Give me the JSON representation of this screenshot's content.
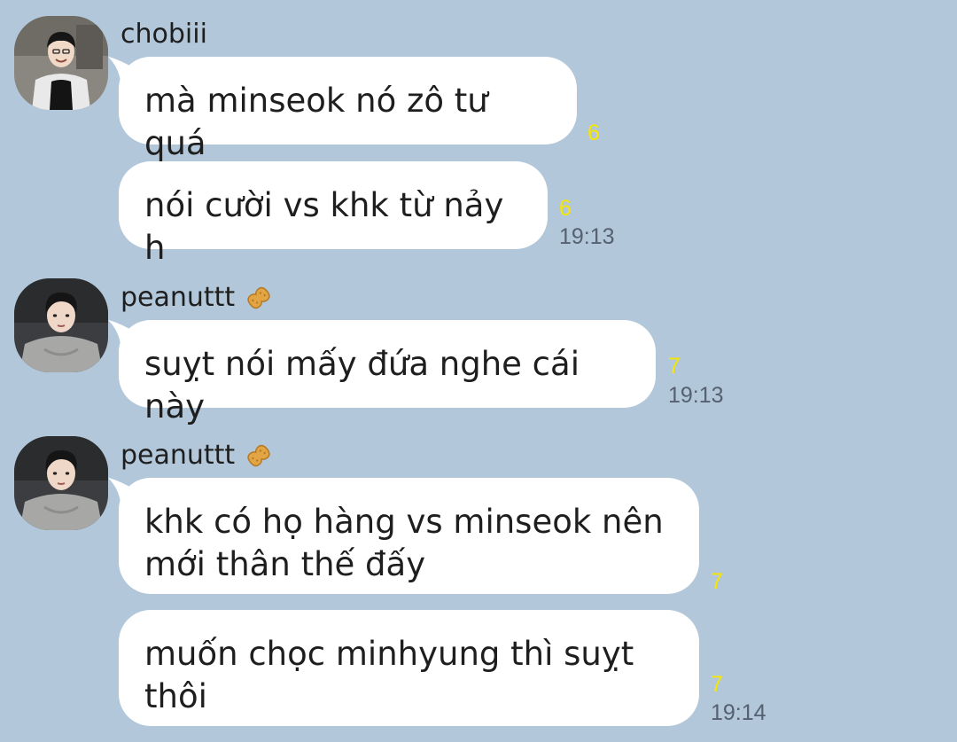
{
  "messages": [
    {
      "sender": "chobiii",
      "avatar_icon": "profile-photo-boy-hoodie-icon",
      "bubbles": [
        {
          "text": "mà minseok nó zô tư quá",
          "unread": "6",
          "time": ""
        },
        {
          "text": "nói cười vs khk từ nảy h",
          "unread": "6",
          "time": "19:13"
        }
      ]
    },
    {
      "sender": "peanuttt",
      "sender_emoji": "peanut-icon",
      "avatar_icon": "profile-photo-boy-gray-hoodie-icon",
      "bubbles": [
        {
          "text": "suỵt nói mấy đứa nghe cái này",
          "unread": "7",
          "time": "19:13"
        }
      ]
    },
    {
      "sender": "peanuttt",
      "sender_emoji": "peanut-icon",
      "avatar_icon": "profile-photo-boy-gray-hoodie-icon",
      "bubbles": [
        {
          "text": "khk có họ hàng vs minseok nên mới thân thế đấy",
          "unread": "7",
          "time": ""
        },
        {
          "text": "muốn chọc minhyung thì suỵt thôi",
          "unread": "7",
          "time": "19:14"
        }
      ]
    }
  ],
  "colors": {
    "background": "#b2c7da",
    "bubble": "#ffffff",
    "unread": "#f7e600",
    "time": "#556070"
  }
}
